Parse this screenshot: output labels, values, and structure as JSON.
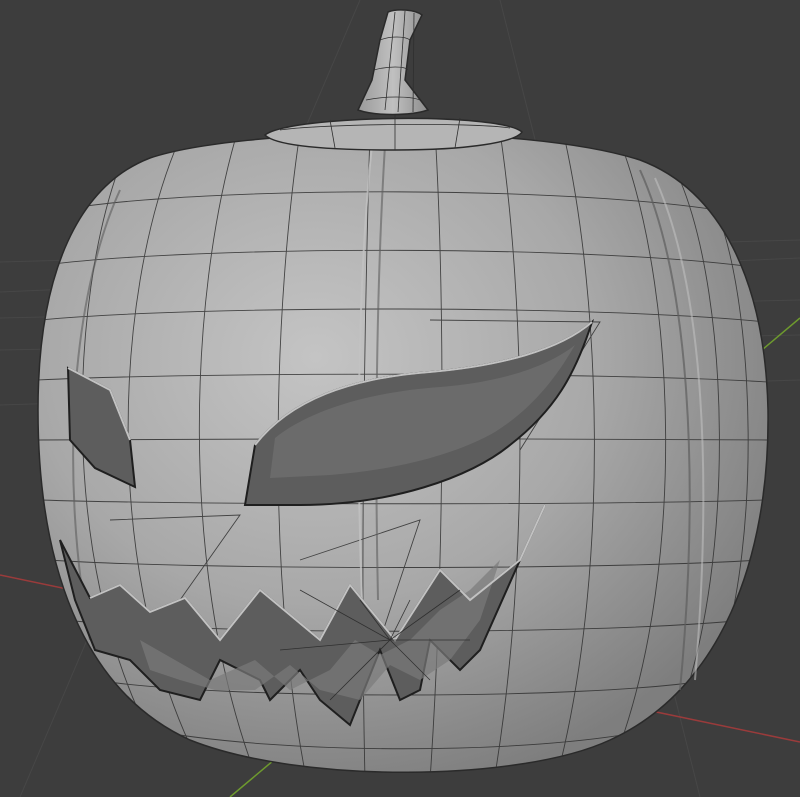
{
  "viewport": {
    "background": "#3d3d3d",
    "grid_color": "#474747",
    "x_axis_color": "#9a3b3b",
    "y_axis_color": "#6e9a2e",
    "wire_color": "#2f2f2f"
  },
  "pumpkin": {
    "mesh_color": "#a6a6a6",
    "cavity_color": "#5d5d5d",
    "highlight_color": "#c2c2c2"
  }
}
